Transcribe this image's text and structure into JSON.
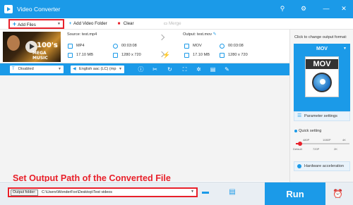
{
  "app": {
    "title": "Video Converter",
    "window_buttons": {
      "key": "⚲",
      "settings": "⚙",
      "minimize": "—",
      "close": "✕"
    }
  },
  "toolbar": {
    "add_files": "Add Files",
    "add_video_folder": "Add Video Folder",
    "clear": "Clear",
    "merge": "Merge"
  },
  "file": {
    "thumbnail_text": {
      "big": "100's",
      "mega": "MEGA MUSIC"
    },
    "source": {
      "label": "Source: test.mp4",
      "format": "MP4",
      "duration": "00:03:08",
      "size": "17.10 MB",
      "resolution": "1280 x 720"
    },
    "output": {
      "label": "Output: test.mov",
      "format": "MOV",
      "duration": "00:03:08",
      "size": "17.10 MB",
      "resolution": "1280 x 720"
    }
  },
  "editbar": {
    "subtitle_value": "Disabled",
    "audio_value": "English aac (LC) (mp"
  },
  "overlay": {
    "caption": "Set Output Path of the Converted File"
  },
  "right_panel": {
    "change_format_label": "Click to change output format:",
    "format": "MOV",
    "format_icon_text": "MOV",
    "parameter_settings": "Parameter settings",
    "quick_setting": "Quick setting",
    "quality_top": [
      "480P",
      "1080P",
      "4K"
    ],
    "quality_bottom": [
      "Default",
      "720P",
      "2K"
    ],
    "quality_level_percent": 8,
    "hardware_acceleration": "Hardware acceleration"
  },
  "bottom": {
    "output_folder_label": "Output folder:",
    "output_path": "C:\\Users\\WonderFox\\Desktop\\Test videos",
    "run": "Run"
  },
  "colors": {
    "accent": "#1b9ae8",
    "highlight": "#e8202a"
  }
}
